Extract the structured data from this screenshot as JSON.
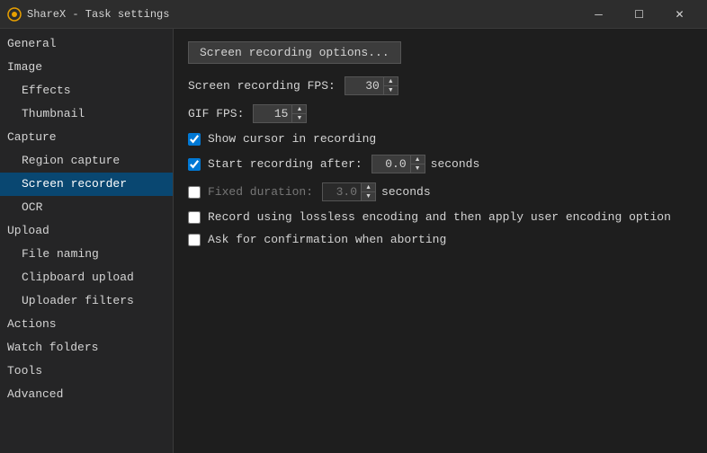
{
  "titleBar": {
    "icon": "sharex-icon",
    "title": "ShareX - Task settings",
    "minimize": "─",
    "maximize": "☐",
    "close": "✕"
  },
  "sidebar": {
    "items": [
      {
        "id": "general",
        "label": "General",
        "level": "category",
        "active": false
      },
      {
        "id": "image",
        "label": "Image",
        "level": "category",
        "active": false
      },
      {
        "id": "effects",
        "label": "Effects",
        "level": "sub",
        "active": false
      },
      {
        "id": "thumbnail",
        "label": "Thumbnail",
        "level": "sub",
        "active": false
      },
      {
        "id": "capture",
        "label": "Capture",
        "level": "category",
        "active": false
      },
      {
        "id": "region-capture",
        "label": "Region capture",
        "level": "sub",
        "active": false
      },
      {
        "id": "screen-recorder",
        "label": "Screen recorder",
        "level": "sub",
        "active": true
      },
      {
        "id": "ocr",
        "label": "OCR",
        "level": "sub",
        "active": false
      },
      {
        "id": "upload",
        "label": "Upload",
        "level": "category",
        "active": false
      },
      {
        "id": "file-naming",
        "label": "File naming",
        "level": "sub",
        "active": false
      },
      {
        "id": "clipboard-upload",
        "label": "Clipboard upload",
        "level": "sub",
        "active": false
      },
      {
        "id": "uploader-filters",
        "label": "Uploader filters",
        "level": "sub",
        "active": false
      },
      {
        "id": "actions",
        "label": "Actions",
        "level": "category",
        "active": false
      },
      {
        "id": "watch-folders",
        "label": "Watch folders",
        "level": "category",
        "active": false
      },
      {
        "id": "tools",
        "label": "Tools",
        "level": "category",
        "active": false
      },
      {
        "id": "advanced",
        "label": "Advanced",
        "level": "category",
        "active": false
      }
    ]
  },
  "content": {
    "screenRecordingBtn": "Screen recording options...",
    "screenRecordingFpsLabel": "Screen recording FPS:",
    "screenRecordingFpsValue": "30",
    "gifFpsLabel": "GIF FPS:",
    "gifFpsValue": "15",
    "showCursorLabel": "Show cursor in recording",
    "showCursorChecked": true,
    "startRecordingLabel": "Start recording after:",
    "startRecordingChecked": true,
    "startRecordingValue": "0.0",
    "startRecordingSeconds": "seconds",
    "fixedDurationLabel": "Fixed duration:",
    "fixedDurationChecked": false,
    "fixedDurationValue": "3.0",
    "fixedDurationSeconds": "seconds",
    "losslessLabel": "Record using lossless encoding and then apply user encoding option",
    "losslessChecked": false,
    "askConfirmLabel": "Ask for confirmation when aborting",
    "askConfirmChecked": false
  }
}
